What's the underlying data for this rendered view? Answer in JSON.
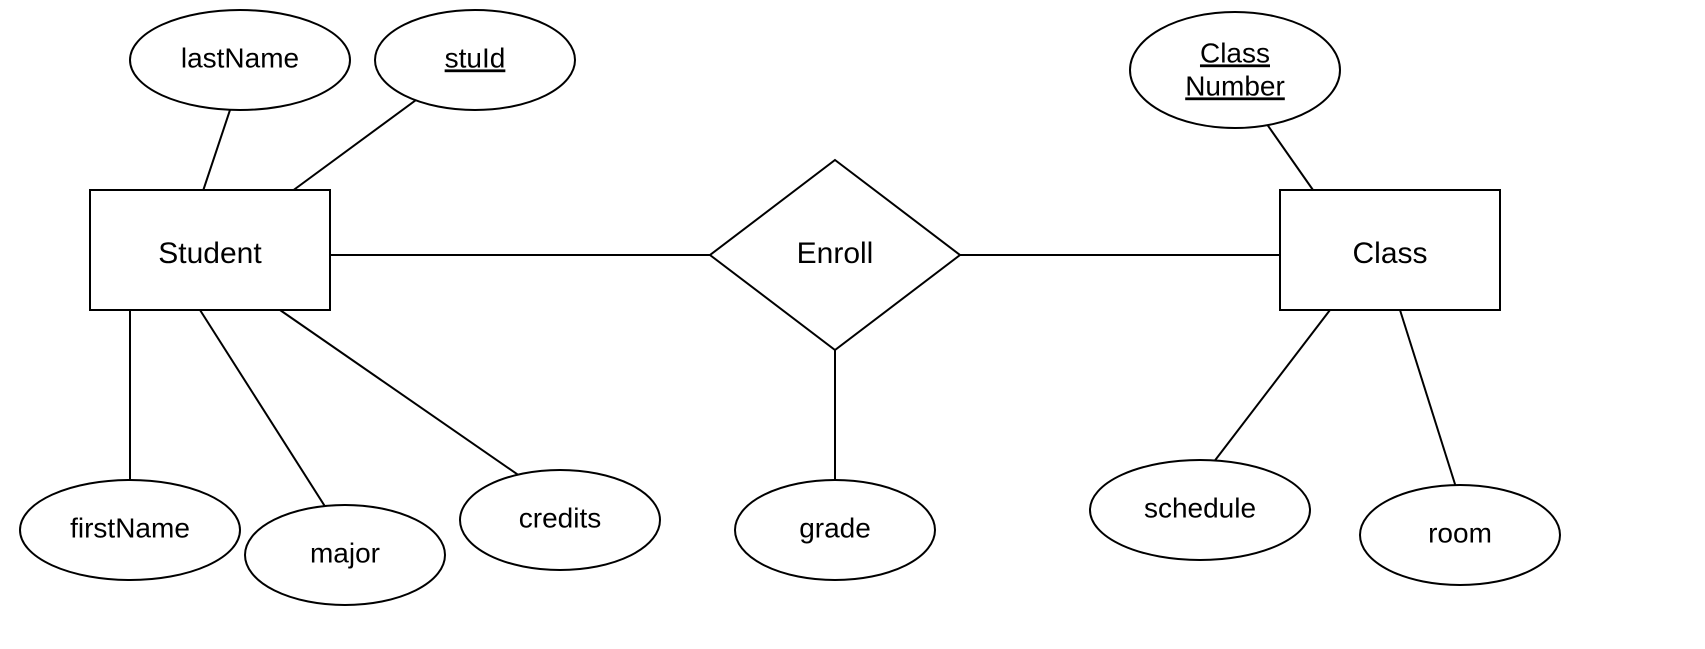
{
  "entities": {
    "student": {
      "label": "Student"
    },
    "class": {
      "label": "Class"
    }
  },
  "relationships": {
    "enroll": {
      "label": "Enroll"
    }
  },
  "attributes": {
    "lastName": {
      "label": "lastName"
    },
    "stuId": {
      "label": "stuId"
    },
    "firstName": {
      "label": "firstName"
    },
    "major": {
      "label": "major"
    },
    "credits": {
      "label": "credits"
    },
    "grade": {
      "label": "grade"
    },
    "classNumber1": {
      "label": "Class"
    },
    "classNumber2": {
      "label": "Number"
    },
    "schedule": {
      "label": "schedule"
    },
    "room": {
      "label": "room"
    }
  }
}
